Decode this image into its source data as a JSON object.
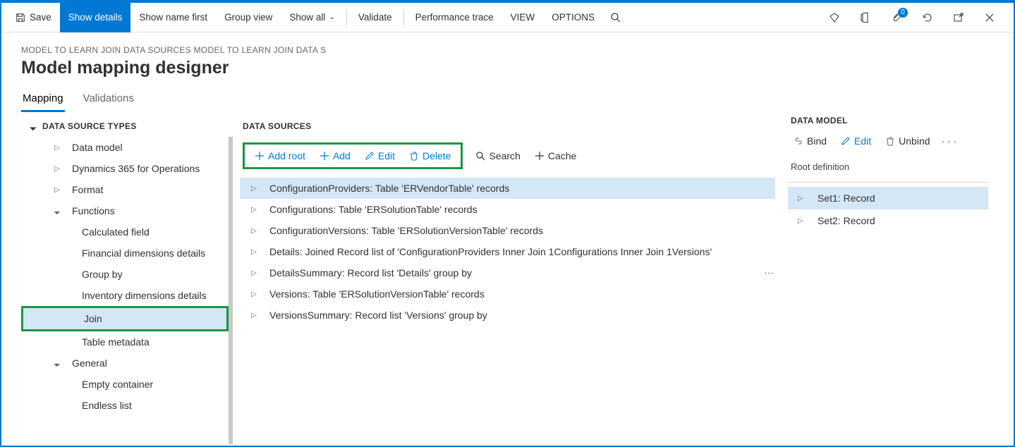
{
  "toolbar": {
    "save": "Save",
    "show_details": "Show details",
    "show_name_first": "Show name first",
    "group_view": "Group view",
    "show_all": "Show all",
    "validate": "Validate",
    "performance_trace": "Performance trace",
    "view": "VIEW",
    "options": "OPTIONS",
    "badge_count": "0"
  },
  "breadcrumb": "MODEL TO LEARN JOIN DATA SOURCES MODEL TO LEARN JOIN DATA S",
  "page_title": "Model mapping designer",
  "tabs": {
    "mapping": "Mapping",
    "validations": "Validations"
  },
  "left": {
    "header": "DATA SOURCE TYPES",
    "items": [
      {
        "label": "Data model",
        "level": 0,
        "caret": "right"
      },
      {
        "label": "Dynamics 365 for Operations",
        "level": 0,
        "caret": "right"
      },
      {
        "label": "Format",
        "level": 0,
        "caret": "right"
      },
      {
        "label": "Functions",
        "level": 0,
        "caret": "down"
      },
      {
        "label": "Calculated field",
        "level": 1
      },
      {
        "label": "Financial dimensions details",
        "level": 1
      },
      {
        "label": "Group by",
        "level": 1
      },
      {
        "label": "Inventory dimensions details",
        "level": 1
      },
      {
        "label": "Join",
        "level": 1,
        "selected": true,
        "highlight": true
      },
      {
        "label": "Table metadata",
        "level": 1
      },
      {
        "label": "General",
        "level": 0,
        "caret": "down"
      },
      {
        "label": "Empty container",
        "level": 1
      },
      {
        "label": "Endless list",
        "level": 1
      }
    ]
  },
  "middle": {
    "header": "DATA SOURCES",
    "actions": {
      "add_root": "Add root",
      "add": "Add",
      "edit": "Edit",
      "delete": "Delete",
      "search": "Search",
      "cache": "Cache"
    },
    "items": [
      {
        "label": "ConfigurationProviders: Table 'ERVendorTable' records",
        "selected": true
      },
      {
        "label": "Configurations: Table 'ERSolutionTable' records"
      },
      {
        "label": "ConfigurationVersions: Table 'ERSolutionVersionTable' records"
      },
      {
        "label": "Details: Joined Record list of 'ConfigurationProviders Inner Join 1Configurations Inner Join 1Versions'"
      },
      {
        "label": "DetailsSummary: Record list 'Details' group by",
        "more": true
      },
      {
        "label": "Versions: Table 'ERSolutionVersionTable' records"
      },
      {
        "label": "VersionsSummary: Record list 'Versions' group by"
      }
    ]
  },
  "right": {
    "header": "DATA MODEL",
    "actions": {
      "bind": "Bind",
      "edit": "Edit",
      "unbind": "Unbind"
    },
    "sub": "Root definition",
    "items": [
      {
        "label": "Set1: Record",
        "selected": true
      },
      {
        "label": "Set2: Record"
      }
    ]
  }
}
